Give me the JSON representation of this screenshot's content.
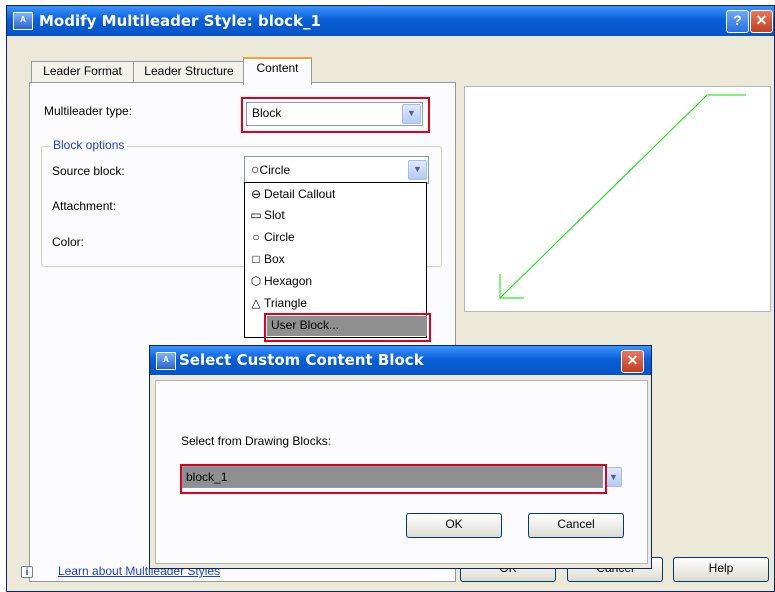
{
  "main_window": {
    "title": "Modify Multileader Style: block_1",
    "help_glyph": "?",
    "close_glyph": "✕",
    "app_icon_text": "A"
  },
  "tabs": [
    {
      "label": "Leader Format",
      "active": false
    },
    {
      "label": "Leader Structure",
      "active": false
    },
    {
      "label": "Content",
      "active": true
    }
  ],
  "content": {
    "multileader_type_label": "Multileader type:",
    "multileader_type_value": "Block",
    "block_options_label": "Block options",
    "source_block_label": "Source block:",
    "source_block_value": "Circle",
    "attachment_label": "Attachment:",
    "color_label": "Color:"
  },
  "source_block_options": [
    {
      "label": "Detail Callout",
      "icon": "detail-callout-icon"
    },
    {
      "label": "Slot",
      "icon": "slot-icon"
    },
    {
      "label": "Circle",
      "icon": "circle-icon"
    },
    {
      "label": "Box",
      "icon": "box-icon"
    },
    {
      "label": "Hexagon",
      "icon": "hexagon-icon"
    },
    {
      "label": "Triangle",
      "icon": "triangle-icon"
    },
    {
      "label": "User Block...",
      "icon": "",
      "highlighted": true
    }
  ],
  "footer": {
    "info_glyph": "i",
    "learn_link": "Learn about Multileader Styles",
    "ok_label": "OK",
    "cancel_label": "Cancel",
    "help_label": "Help"
  },
  "sub_dialog": {
    "title": "Select Custom Content Block",
    "close_glyph": "✕",
    "prompt_label": "Select from Drawing Blocks:",
    "selected_block": "block_1",
    "ok_label": "OK",
    "cancel_label": "Cancel"
  },
  "colors": {
    "title_bar": "#0a5fd8",
    "highlight_box": "#e0001b",
    "preview_leader": "#00e600",
    "selection": "#8f8f8f"
  }
}
